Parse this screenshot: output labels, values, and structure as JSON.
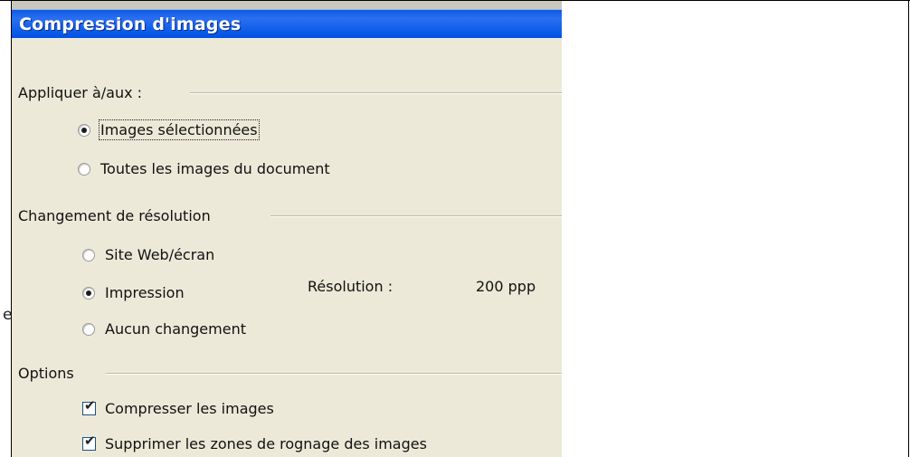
{
  "dialog": {
    "title": "Compression d'images"
  },
  "apply_group": {
    "label": "Appliquer à/aux :",
    "options": [
      {
        "label": "Images sélectionnées",
        "selected": true
      },
      {
        "label": "Toutes les images du document",
        "selected": false
      }
    ]
  },
  "resolution_group": {
    "label": "Changement de résolution",
    "options": [
      {
        "label": "Site Web/écran",
        "selected": false
      },
      {
        "label": "Impression",
        "selected": true
      },
      {
        "label": "Aucun changement",
        "selected": false
      }
    ],
    "resolution_label": "Résolution :",
    "resolution_value": "200 ppp"
  },
  "options_group": {
    "label": "Options",
    "checkboxes": [
      {
        "label": "Compresser les images",
        "checked": true
      },
      {
        "label": "Supprimer les zones de rognage des images",
        "checked": true
      }
    ]
  },
  "background": {
    "clipped_char": "e"
  },
  "colors": {
    "title_bar": "#0a5ae0",
    "dialog_bg": "#ece9d8"
  }
}
